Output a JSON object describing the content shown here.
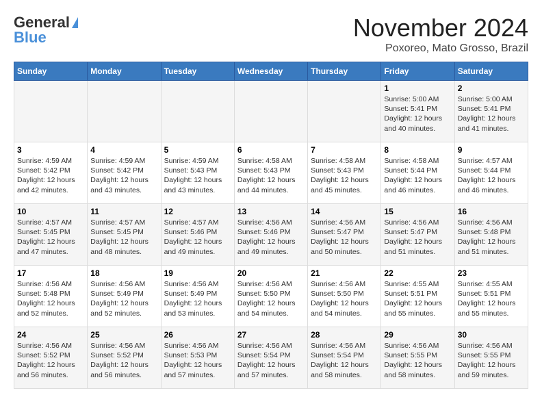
{
  "header": {
    "logo_line1": "General",
    "logo_line2": "Blue",
    "title": "November 2024",
    "subtitle": "Poxoreo, Mato Grosso, Brazil"
  },
  "days_of_week": [
    "Sunday",
    "Monday",
    "Tuesday",
    "Wednesday",
    "Thursday",
    "Friday",
    "Saturday"
  ],
  "weeks": [
    {
      "cells": [
        {
          "day": "",
          "info": ""
        },
        {
          "day": "",
          "info": ""
        },
        {
          "day": "",
          "info": ""
        },
        {
          "day": "",
          "info": ""
        },
        {
          "day": "",
          "info": ""
        },
        {
          "day": "1",
          "info": "Sunrise: 5:00 AM\nSunset: 5:41 PM\nDaylight: 12 hours\nand 40 minutes."
        },
        {
          "day": "2",
          "info": "Sunrise: 5:00 AM\nSunset: 5:41 PM\nDaylight: 12 hours\nand 41 minutes."
        }
      ]
    },
    {
      "cells": [
        {
          "day": "3",
          "info": "Sunrise: 4:59 AM\nSunset: 5:42 PM\nDaylight: 12 hours\nand 42 minutes."
        },
        {
          "day": "4",
          "info": "Sunrise: 4:59 AM\nSunset: 5:42 PM\nDaylight: 12 hours\nand 43 minutes."
        },
        {
          "day": "5",
          "info": "Sunrise: 4:59 AM\nSunset: 5:43 PM\nDaylight: 12 hours\nand 43 minutes."
        },
        {
          "day": "6",
          "info": "Sunrise: 4:58 AM\nSunset: 5:43 PM\nDaylight: 12 hours\nand 44 minutes."
        },
        {
          "day": "7",
          "info": "Sunrise: 4:58 AM\nSunset: 5:43 PM\nDaylight: 12 hours\nand 45 minutes."
        },
        {
          "day": "8",
          "info": "Sunrise: 4:58 AM\nSunset: 5:44 PM\nDaylight: 12 hours\nand 46 minutes."
        },
        {
          "day": "9",
          "info": "Sunrise: 4:57 AM\nSunset: 5:44 PM\nDaylight: 12 hours\nand 46 minutes."
        }
      ]
    },
    {
      "cells": [
        {
          "day": "10",
          "info": "Sunrise: 4:57 AM\nSunset: 5:45 PM\nDaylight: 12 hours\nand 47 minutes."
        },
        {
          "day": "11",
          "info": "Sunrise: 4:57 AM\nSunset: 5:45 PM\nDaylight: 12 hours\nand 48 minutes."
        },
        {
          "day": "12",
          "info": "Sunrise: 4:57 AM\nSunset: 5:46 PM\nDaylight: 12 hours\nand 49 minutes."
        },
        {
          "day": "13",
          "info": "Sunrise: 4:56 AM\nSunset: 5:46 PM\nDaylight: 12 hours\nand 49 minutes."
        },
        {
          "day": "14",
          "info": "Sunrise: 4:56 AM\nSunset: 5:47 PM\nDaylight: 12 hours\nand 50 minutes."
        },
        {
          "day": "15",
          "info": "Sunrise: 4:56 AM\nSunset: 5:47 PM\nDaylight: 12 hours\nand 51 minutes."
        },
        {
          "day": "16",
          "info": "Sunrise: 4:56 AM\nSunset: 5:48 PM\nDaylight: 12 hours\nand 51 minutes."
        }
      ]
    },
    {
      "cells": [
        {
          "day": "17",
          "info": "Sunrise: 4:56 AM\nSunset: 5:48 PM\nDaylight: 12 hours\nand 52 minutes."
        },
        {
          "day": "18",
          "info": "Sunrise: 4:56 AM\nSunset: 5:49 PM\nDaylight: 12 hours\nand 52 minutes."
        },
        {
          "day": "19",
          "info": "Sunrise: 4:56 AM\nSunset: 5:49 PM\nDaylight: 12 hours\nand 53 minutes."
        },
        {
          "day": "20",
          "info": "Sunrise: 4:56 AM\nSunset: 5:50 PM\nDaylight: 12 hours\nand 54 minutes."
        },
        {
          "day": "21",
          "info": "Sunrise: 4:56 AM\nSunset: 5:50 PM\nDaylight: 12 hours\nand 54 minutes."
        },
        {
          "day": "22",
          "info": "Sunrise: 4:55 AM\nSunset: 5:51 PM\nDaylight: 12 hours\nand 55 minutes."
        },
        {
          "day": "23",
          "info": "Sunrise: 4:55 AM\nSunset: 5:51 PM\nDaylight: 12 hours\nand 55 minutes."
        }
      ]
    },
    {
      "cells": [
        {
          "day": "24",
          "info": "Sunrise: 4:56 AM\nSunset: 5:52 PM\nDaylight: 12 hours\nand 56 minutes."
        },
        {
          "day": "25",
          "info": "Sunrise: 4:56 AM\nSunset: 5:52 PM\nDaylight: 12 hours\nand 56 minutes."
        },
        {
          "day": "26",
          "info": "Sunrise: 4:56 AM\nSunset: 5:53 PM\nDaylight: 12 hours\nand 57 minutes."
        },
        {
          "day": "27",
          "info": "Sunrise: 4:56 AM\nSunset: 5:54 PM\nDaylight: 12 hours\nand 57 minutes."
        },
        {
          "day": "28",
          "info": "Sunrise: 4:56 AM\nSunset: 5:54 PM\nDaylight: 12 hours\nand 58 minutes."
        },
        {
          "day": "29",
          "info": "Sunrise: 4:56 AM\nSunset: 5:55 PM\nDaylight: 12 hours\nand 58 minutes."
        },
        {
          "day": "30",
          "info": "Sunrise: 4:56 AM\nSunset: 5:55 PM\nDaylight: 12 hours\nand 59 minutes."
        }
      ]
    }
  ]
}
